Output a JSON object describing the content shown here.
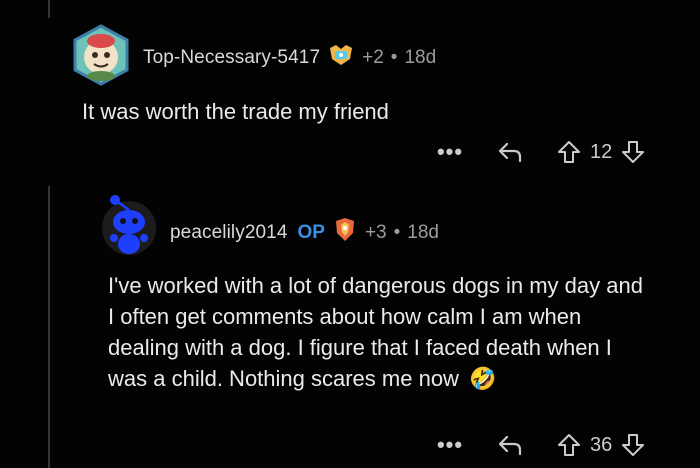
{
  "comments": [
    {
      "username": "Top-Necessary-5417",
      "award_count": "+2",
      "age": "18d",
      "text": "It was worth the trade my friend",
      "more": "•••",
      "score": "12"
    },
    {
      "username": "peacelily2014",
      "op_label": "OP",
      "award_count": "+3",
      "age": "18d",
      "text": "I've worked with a lot of dangerous dogs in my day and I often get comments about how calm I am when dealing with a dog. I figure that I faced death when I was a child. Nothing scares me now",
      "emoji": "🤣",
      "more": "•••",
      "score": "36"
    }
  ],
  "colors": {
    "background": "#030303",
    "text": "#d7dadc",
    "op": "#3a8fe6",
    "meta": "#9a9c9e",
    "snoo": "#1f3fff"
  }
}
